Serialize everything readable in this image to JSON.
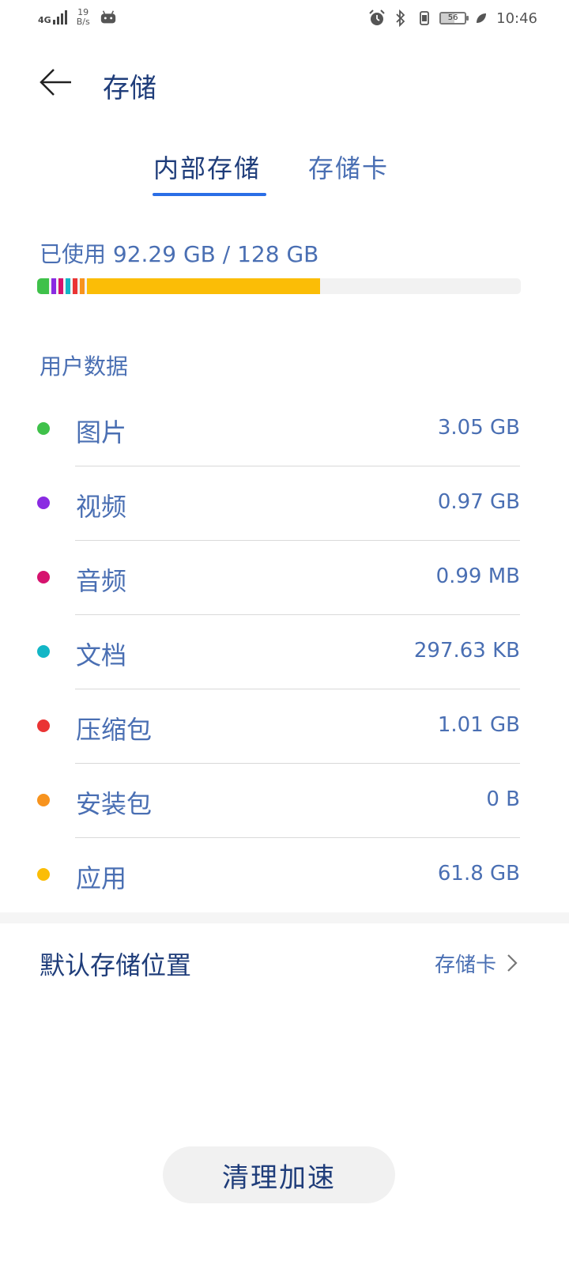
{
  "status_bar": {
    "network": "4G",
    "net_speed_value": "19",
    "net_speed_unit": "B/s",
    "battery": "56",
    "battery_level": 0.56,
    "time": "10:46",
    "icons": [
      "signal-icon",
      "android-debug-icon",
      "alarm-icon",
      "bluetooth-icon",
      "vibrate-icon",
      "battery-icon",
      "leaf-icon"
    ]
  },
  "header": {
    "title": "存储"
  },
  "tabs": [
    {
      "label": "内部存储",
      "selected": true
    },
    {
      "label": "存储卡",
      "selected": false
    }
  ],
  "usage": {
    "label": "已使用 92.29 GB / 128 GB",
    "used_gb": 92.29,
    "total_gb": 128
  },
  "section": {
    "title": "用户数据"
  },
  "categories": [
    {
      "name": "图片",
      "size": "3.05 GB",
      "color": "#3fc14a"
    },
    {
      "name": "视频",
      "size": "0.97 GB",
      "color": "#8a2be2"
    },
    {
      "name": "音频",
      "size": "0.99 MB",
      "color": "#d6136e"
    },
    {
      "name": "文档",
      "size": "297.63 KB",
      "color": "#13b6c6"
    },
    {
      "name": "压缩包",
      "size": "1.01 GB",
      "color": "#ea3434"
    },
    {
      "name": "安装包",
      "size": "0 B",
      "color": "#f7931e"
    },
    {
      "name": "应用",
      "size": "61.8 GB",
      "color": "#fbbd06"
    }
  ],
  "default_storage": {
    "label": "默认存储位置",
    "value": "存储卡"
  },
  "clean_button": {
    "label": "清理加速"
  }
}
